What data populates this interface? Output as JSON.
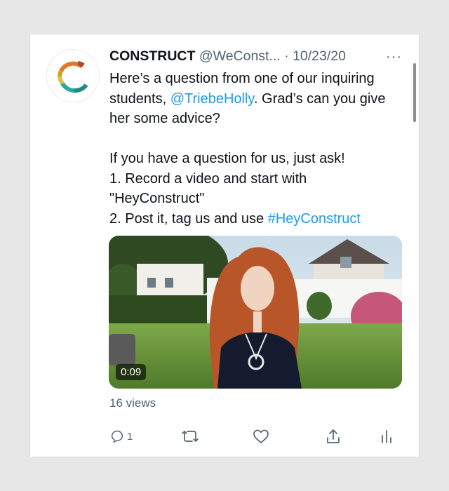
{
  "tweet": {
    "author_name": "CONSTRUCT",
    "author_handle": "@WeConst...",
    "separator": "·",
    "date": "10/23/20",
    "more_label": "···",
    "text": {
      "line1_pre": "Here’s a question from one of our inquiring students, ",
      "mention": "@TriebeHolly",
      "line1_post": ". Grad’s can you give her some advice?",
      "para2_l1": "If you have a question for us, just ask!",
      "para2_l2": "1. Record a video and start with \"HeyConstruct\"",
      "para2_l3_pre": "2. Post it, tag us and use ",
      "hashtag": "#HeyConstruct"
    },
    "video": {
      "duration": "0:09"
    },
    "views": "16 views",
    "actions": {
      "reply_count": "1",
      "icons": [
        "reply-icon",
        "retweet-icon",
        "like-icon",
        "share-icon",
        "analytics-icon"
      ]
    }
  },
  "colors": {
    "link": "#1d9bf0",
    "text": "#0f1419",
    "muted": "#536471",
    "background": "#e7e7e7"
  }
}
